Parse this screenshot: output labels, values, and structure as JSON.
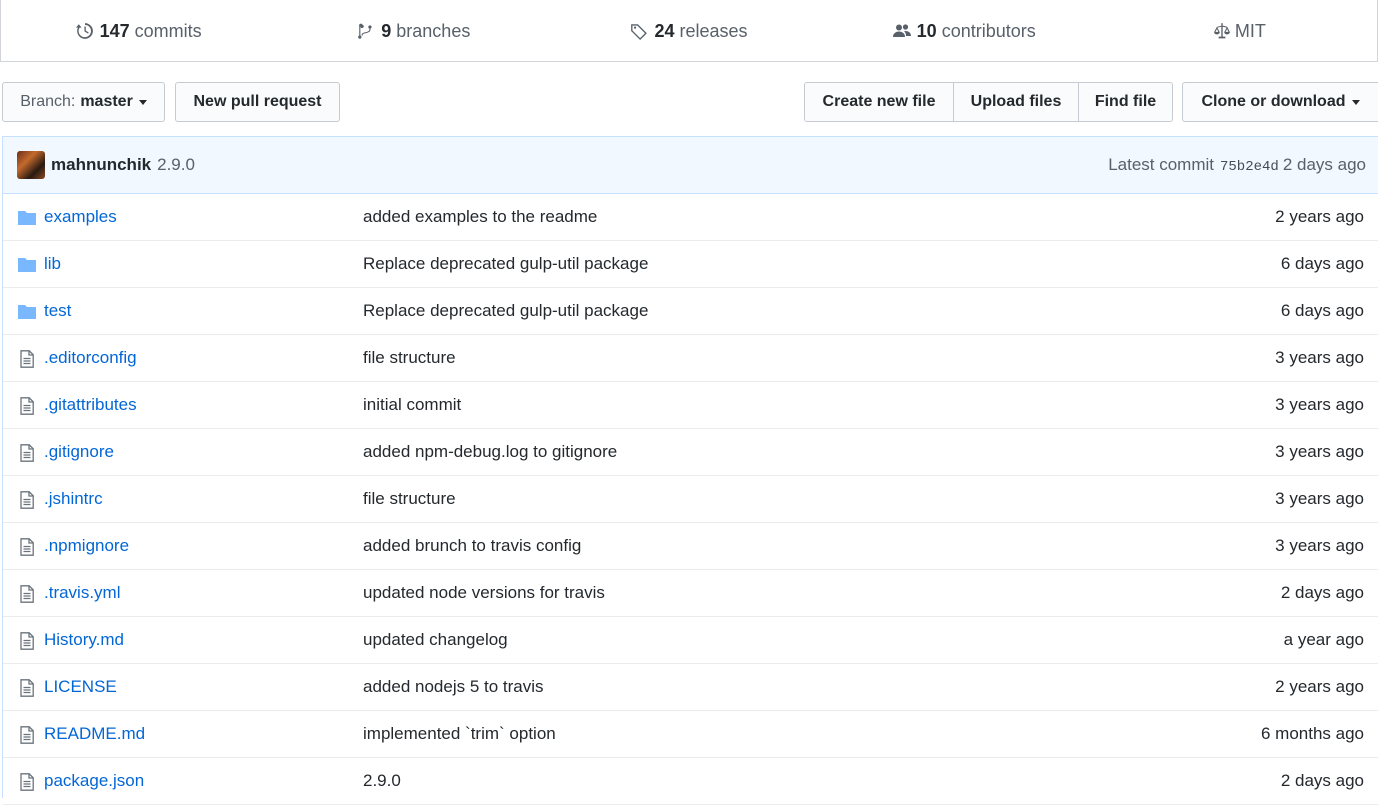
{
  "summary": {
    "commits": {
      "count": "147",
      "label": "commits"
    },
    "branches": {
      "count": "9",
      "label": "branches"
    },
    "releases": {
      "count": "24",
      "label": "releases"
    },
    "contributors": {
      "count": "10",
      "label": "contributors"
    },
    "license": {
      "label": "MIT"
    }
  },
  "toolbar": {
    "branch_prefix": "Branch:",
    "branch_name": "master",
    "new_pr": "New pull request",
    "create_file": "Create new file",
    "upload_files": "Upload files",
    "find_file": "Find file",
    "clone": "Clone or download"
  },
  "latest_commit": {
    "author": "mahnunchik",
    "message": "2.9.0",
    "prefix": "Latest commit",
    "sha": "75b2e4d",
    "age": "2 days ago"
  },
  "files": [
    {
      "type": "folder",
      "name": "examples",
      "message": "added examples to the readme",
      "age": "2 years ago"
    },
    {
      "type": "folder",
      "name": "lib",
      "message": "Replace deprecated gulp-util package",
      "age": "6 days ago"
    },
    {
      "type": "folder",
      "name": "test",
      "message": "Replace deprecated gulp-util package",
      "age": "6 days ago"
    },
    {
      "type": "file",
      "name": ".editorconfig",
      "message": "file structure",
      "age": "3 years ago"
    },
    {
      "type": "file",
      "name": ".gitattributes",
      "message": "initial commit",
      "age": "3 years ago"
    },
    {
      "type": "file",
      "name": ".gitignore",
      "message": "added npm-debug.log to gitignore",
      "age": "3 years ago"
    },
    {
      "type": "file",
      "name": ".jshintrc",
      "message": "file structure",
      "age": "3 years ago"
    },
    {
      "type": "file",
      "name": ".npmignore",
      "message": "added brunch to travis config",
      "age": "3 years ago"
    },
    {
      "type": "file",
      "name": ".travis.yml",
      "message": "updated node versions for travis",
      "age": "2 days ago"
    },
    {
      "type": "file",
      "name": "History.md",
      "message": "updated changelog",
      "age": "a year ago"
    },
    {
      "type": "file",
      "name": "LICENSE",
      "message": "added nodejs 5 to travis",
      "age": "2 years ago"
    },
    {
      "type": "file",
      "name": "README.md",
      "message": "implemented `trim` option",
      "age": "6 months ago"
    },
    {
      "type": "file",
      "name": "package.json",
      "message": "2.9.0",
      "age": "2 days ago"
    }
  ],
  "icons": {
    "commits": "history-icon",
    "branches": "git-branch-icon",
    "releases": "tag-icon",
    "contributors": "people-icon",
    "license": "law-icon",
    "folder": "folder-icon",
    "file": "file-icon"
  },
  "colors": {
    "link": "#0366d6",
    "folder": "#79b8ff",
    "commit_bar_bg": "#f1f8ff",
    "border": "#c8e1ff"
  }
}
